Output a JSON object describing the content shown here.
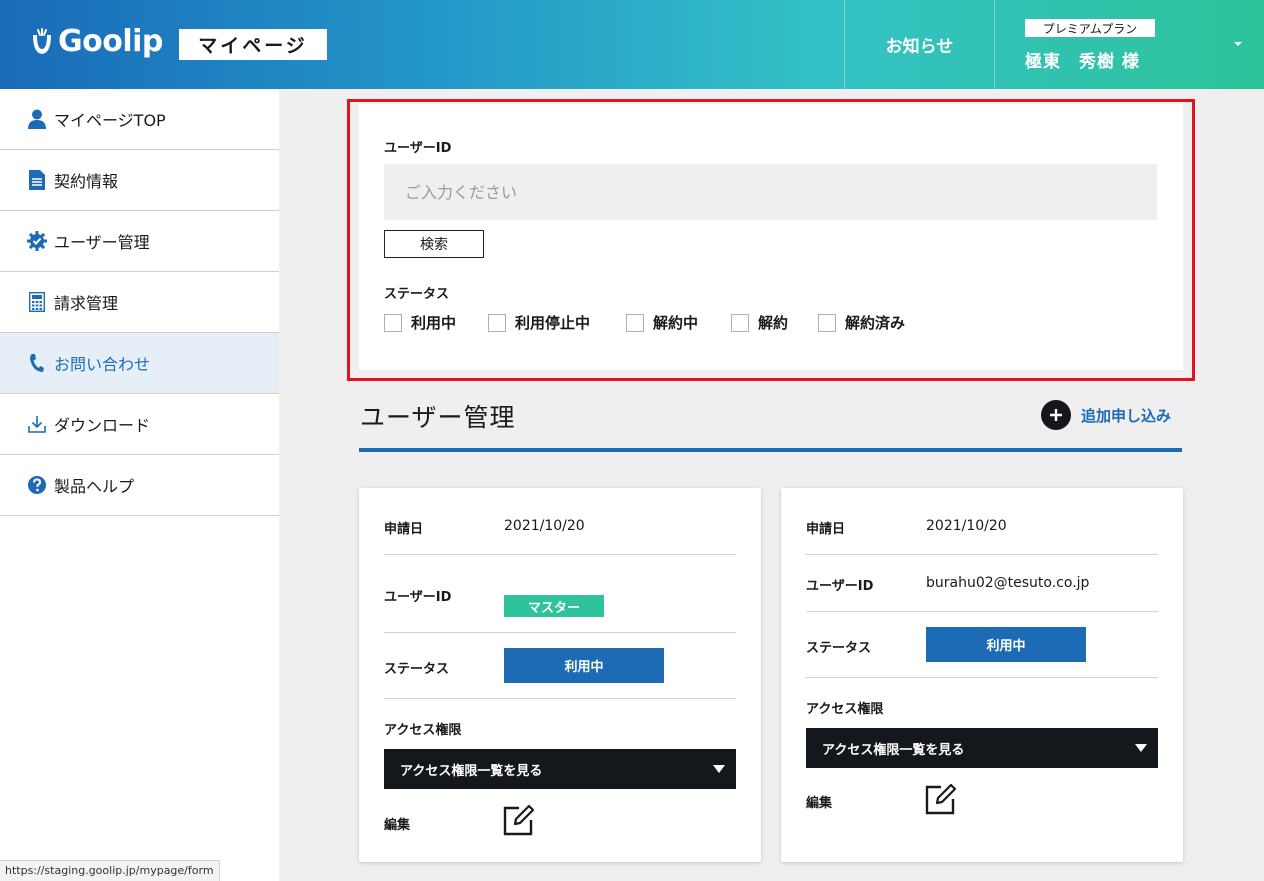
{
  "header": {
    "logo_text": "Goolip",
    "section_badge": "マイページ",
    "notice_label": "お知らせ",
    "plan_badge": "プレミアムプラン",
    "user_name": "極東　秀樹 様"
  },
  "sidebar": {
    "items": [
      {
        "label": "マイページTOP",
        "icon": "user-icon"
      },
      {
        "label": "契約情報",
        "icon": "document-icon"
      },
      {
        "label": "ユーザー管理",
        "icon": "gear-check-icon"
      },
      {
        "label": "請求管理",
        "icon": "calculator-icon"
      },
      {
        "label": "お問い合わせ",
        "icon": "phone-icon",
        "active": true
      },
      {
        "label": "ダウンロード",
        "icon": "download-icon"
      },
      {
        "label": "製品ヘルプ",
        "icon": "help-icon"
      }
    ]
  },
  "search": {
    "user_id_label": "ユーザーID",
    "user_id_placeholder": "ご入力ください",
    "user_id_value": "",
    "search_button": "検索",
    "status_label": "ステータス",
    "status_options": [
      "利用中",
      "利用停止中",
      "解約中",
      "解約",
      "解約済み"
    ]
  },
  "user_management": {
    "title": "ユーザー管理",
    "add_label": "追加申し込み"
  },
  "cards": [
    {
      "applied_label": "申請日",
      "applied_date": "2021/10/20",
      "user_id_label": "ユーザーID",
      "user_id_badge": "マスター",
      "status_label": "ステータス",
      "status_value": "利用中",
      "access_label": "アクセス権限",
      "access_dropdown": "アクセス権限一覧を見る",
      "edit_label": "編集"
    },
    {
      "applied_label": "申請日",
      "applied_date": "2021/10/20",
      "user_id_label": "ユーザーID",
      "user_id_value": "burahu02@tesuto.co.jp",
      "status_label": "ステータス",
      "status_value": "利用中",
      "access_label": "アクセス権限",
      "access_dropdown": "アクセス権限一覧を見る",
      "edit_label": "編集"
    }
  ],
  "browser_status_url": "https://staging.goolip.jp/mypage/form",
  "colors": {
    "brand_blue": "#1d6bb5",
    "brand_green": "#2ec39a",
    "highlight_red": "#e0141e",
    "dark": "#14171c"
  }
}
